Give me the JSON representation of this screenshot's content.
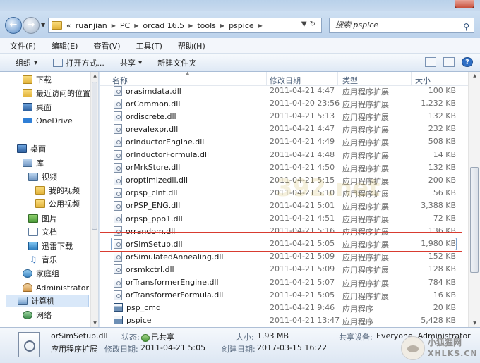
{
  "address": {
    "crumbs": [
      "«",
      "ruanjian",
      "PC",
      "orcad 16.5",
      "tools",
      "pspice"
    ],
    "search_placeholder": "搜索 pspice"
  },
  "menu": [
    "文件(F)",
    "编辑(E)",
    "查看(V)",
    "工具(T)",
    "帮助(H)"
  ],
  "toolbar": {
    "organize": "组织",
    "open_with": "打开方式...",
    "share": "共享",
    "new_folder": "新建文件夹"
  },
  "nav": {
    "downloads": "下载",
    "recent": "最近访问的位置",
    "desktop_fav": "桌面",
    "onedrive": "OneDrive",
    "desktop": "桌面",
    "libraries": "库",
    "videos": "视频",
    "my_videos": "我的视频",
    "public_videos": "公用视频",
    "pictures": "图片",
    "documents": "文档",
    "xunlei": "迅雷下载",
    "music": "音乐",
    "homegroup": "家庭组",
    "administrator": "Administrator",
    "computer": "计算机",
    "network": "网络"
  },
  "columns": {
    "name": "名称",
    "date": "修改日期",
    "type": "类型",
    "size": "大小"
  },
  "files": [
    {
      "name": "orasimdata.dll",
      "date": "2011-04-21 4:47",
      "type": "应用程序扩展",
      "size": "100 KB"
    },
    {
      "name": "orCommon.dll",
      "date": "2011-04-20 23:56",
      "type": "应用程序扩展",
      "size": "1,232 KB"
    },
    {
      "name": "ordiscrete.dll",
      "date": "2011-04-21 5:13",
      "type": "应用程序扩展",
      "size": "132 KB"
    },
    {
      "name": "orevalexpr.dll",
      "date": "2011-04-21 4:47",
      "type": "应用程序扩展",
      "size": "232 KB"
    },
    {
      "name": "orInductorEngine.dll",
      "date": "2011-04-21 4:49",
      "type": "应用程序扩展",
      "size": "508 KB"
    },
    {
      "name": "orInductorFormula.dll",
      "date": "2011-04-21 4:48",
      "type": "应用程序扩展",
      "size": "14 KB"
    },
    {
      "name": "orMrkStore.dll",
      "date": "2011-04-21 4:50",
      "type": "应用程序扩展",
      "size": "132 KB"
    },
    {
      "name": "oroptimizedll.dll",
      "date": "2011-04-21 5:15",
      "type": "应用程序扩展",
      "size": "200 KB"
    },
    {
      "name": "orpsp_clnt.dll",
      "date": "2011-04-21 5:10",
      "type": "应用程序扩展",
      "size": "56 KB"
    },
    {
      "name": "orPSP_ENG.dll",
      "date": "2011-04-21 5:01",
      "type": "应用程序扩展",
      "size": "3,388 KB"
    },
    {
      "name": "orpsp_ppo1.dll",
      "date": "2011-04-21 4:51",
      "type": "应用程序扩展",
      "size": "72 KB"
    },
    {
      "name": "orrandom.dll",
      "date": "2011-04-21 5:16",
      "type": "应用程序扩展",
      "size": "136 KB"
    },
    {
      "name": "orSimSetup.dll",
      "date": "2011-04-21 5:05",
      "type": "应用程序扩展",
      "size": "1,980 KB"
    },
    {
      "name": "orSimulatedAnnealing.dll",
      "date": "2011-04-21 5:09",
      "type": "应用程序扩展",
      "size": "152 KB"
    },
    {
      "name": "orsmkctrl.dll",
      "date": "2011-04-21 5:09",
      "type": "应用程序扩展",
      "size": "128 KB"
    },
    {
      "name": "orTransformerEngine.dll",
      "date": "2011-04-21 5:07",
      "type": "应用程序扩展",
      "size": "784 KB"
    },
    {
      "name": "orTransformerFormula.dll",
      "date": "2011-04-21 5:05",
      "type": "应用程序扩展",
      "size": "16 KB"
    },
    {
      "name": "psp_cmd",
      "date": "2011-04-21 9:46",
      "type": "应用程序",
      "size": "20 KB"
    },
    {
      "name": "pspice",
      "date": "2011-04-21 13:47",
      "type": "应用程序",
      "size": "5,428 KB"
    }
  ],
  "watermark": "392.net",
  "details": {
    "file_name": "orSimSetup.dll",
    "file_type": "应用程序扩展",
    "state_label": "状态:",
    "state_value": "已共享",
    "size_label": "大小:",
    "size_value": "1.93 MB",
    "share_label": "共享设备:",
    "share_value": "Everyone, Administrator",
    "modified_label": "修改日期:",
    "modified_value": "2011-04-21 5:05",
    "created_label": "创建日期:",
    "created_value": "2017-03-15 16:22"
  },
  "brand": {
    "line1": "小狐狸网",
    "line2": "XHLKS.CN"
  }
}
